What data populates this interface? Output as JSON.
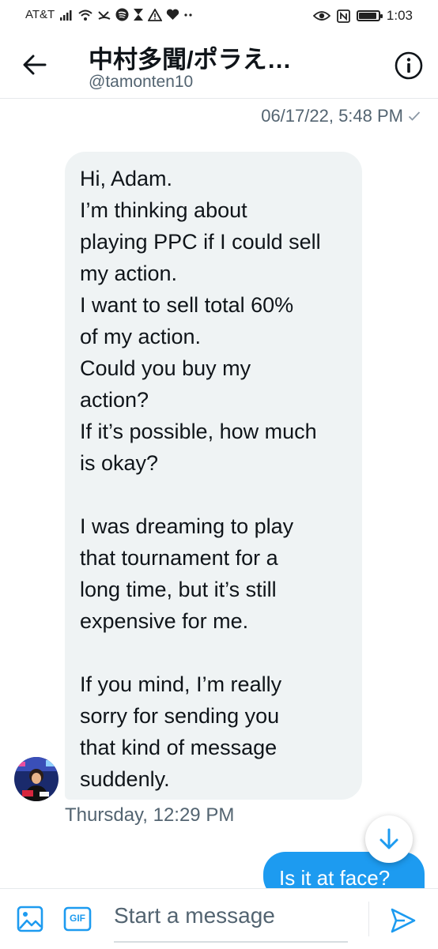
{
  "status_bar": {
    "carrier": "AT&T",
    "time": "1:03",
    "icons": [
      "signal-bars-icon",
      "wifi-icon",
      "missed-call-icon",
      "spotify-icon",
      "hourglass-icon",
      "warning-icon",
      "heart-icon",
      "more-dots-icon",
      "eye-icon",
      "nfc-icon",
      "battery-icon"
    ],
    "battery_level": 0.85
  },
  "header": {
    "title": "中村多聞/ポラえ…",
    "handle": "@tamonten10"
  },
  "conversation": {
    "top_timestamp": "06/17/22, 5:48 PM",
    "received_message_lines": [
      "Hi, Adam.",
      "I’m thinking about",
      "playing PPC if I could sell",
      "my action.",
      "I want to sell total 60%",
      "of my action.",
      "Could you buy my",
      "action?",
      "If it’s possible, how much",
      "is okay?",
      "",
      "I was dreaming to play",
      "that tournament for a",
      "long time, but it’s still",
      "expensive for me.",
      "",
      "If you mind, I’m really",
      "sorry for sending you",
      "that kind of message",
      "suddenly."
    ],
    "received_timestamp": "Thursday, 12:29 PM",
    "sent_message": "Is it at face?"
  },
  "composer": {
    "placeholder": "Start a message",
    "gif_label": "GIF"
  },
  "colors": {
    "accent": "#1d9bf0",
    "bubble_received": "#eff3f4",
    "secondary_text": "#536471"
  }
}
